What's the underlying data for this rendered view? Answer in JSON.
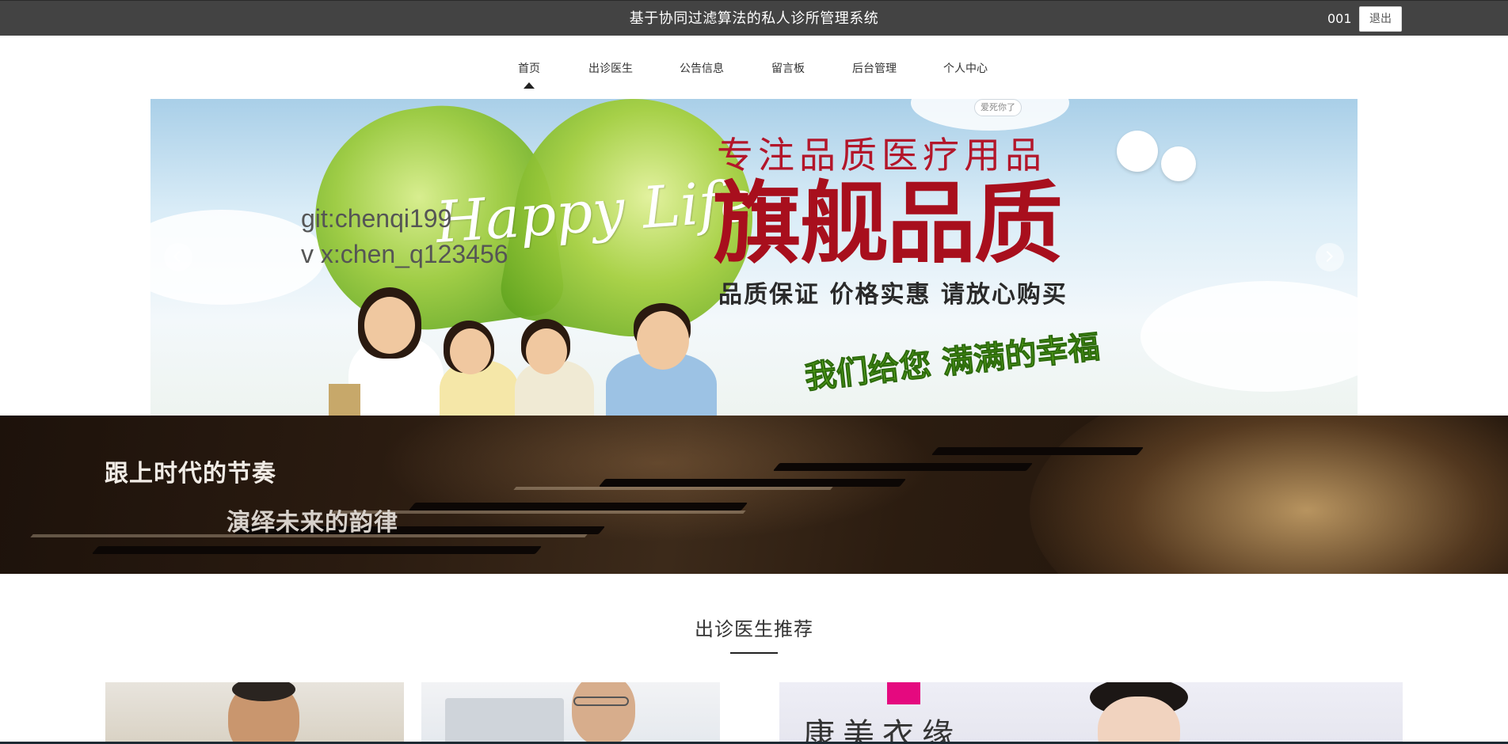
{
  "header": {
    "title": "基于协同过滤算法的私人诊所管理系统",
    "username": "001",
    "logout_label": "退出"
  },
  "nav": {
    "active_index": 0,
    "items": [
      "首页",
      "出诊医生",
      "公告信息",
      "留言板",
      "后台管理",
      "个人中心"
    ]
  },
  "carousel": {
    "overlay_lines": [
      "git:chenqi199",
      "v x:chen_q123456"
    ],
    "banner": {
      "script_text": "Happy Life",
      "slogan_top": "专注品质医疗用品",
      "slogan_main": "旗舰品质",
      "slogan_sub": "品质保证 价格实惠 请放心购买",
      "slogan_green": "我们给您 满满的幸福",
      "corner_badge": "爱死你了"
    },
    "prev_icon": "chevron-left-icon",
    "next_icon": "chevron-right-icon"
  },
  "promo": {
    "line1": "跟上时代的节奏",
    "line2": "演绎未来的韵律"
  },
  "section": {
    "title": "出诊医生推荐"
  },
  "doctor_cards": [
    {
      "type": "doctor-photo"
    },
    {
      "type": "doctor-photo"
    },
    {
      "type": "doctor-photo",
      "brand_text": "康美衣缘"
    }
  ],
  "colors": {
    "topbar_bg": "#434343",
    "text_dark": "#333333",
    "slogan_red": "#a80f1d",
    "brand_pink": "#e5097f"
  }
}
